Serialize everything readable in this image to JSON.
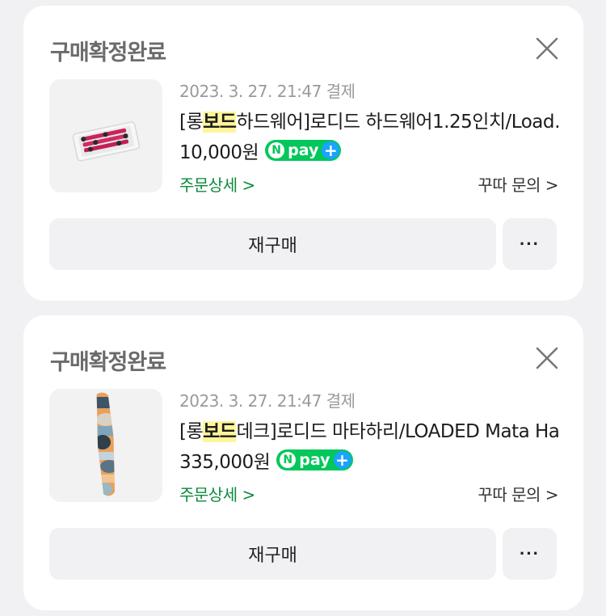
{
  "orders": [
    {
      "status": "구매확정완료",
      "date": "2023. 3. 27. 21:47 결제",
      "title_prefix": "[롱",
      "title_highlight": "보드",
      "title_suffix": "하드웨어]로디드 하드웨어1.25인치/Load…",
      "price": "10,000원",
      "npay_n": "N",
      "npay_text": "pay",
      "npay_plus": "+",
      "detail_label": "주문상세 >",
      "inquiry_label": "꾸따 문의 >",
      "rebuy_label": "재구매",
      "more_label": "···"
    },
    {
      "status": "구매확정완료",
      "date": "2023. 3. 27. 21:47 결제",
      "title_prefix": "[롱",
      "title_highlight": "보드",
      "title_suffix": "데크]로디드 마타하리/LOADED Mata Ha…",
      "price": "335,000원",
      "npay_n": "N",
      "npay_text": "pay",
      "npay_plus": "+",
      "detail_label": "주문상세 >",
      "inquiry_label": "꾸따 문의 >",
      "rebuy_label": "재구매",
      "more_label": "···"
    }
  ],
  "colors": {
    "background": "#f1f1f3",
    "card": "#ffffff",
    "status_text": "#6b6b6b",
    "date_text": "#9a9a9a",
    "highlight": "#fff59a",
    "npay_green": "#03c75a",
    "npay_plus_blue": "#1aa3ff",
    "detail_green": "#0c8a3c"
  },
  "icons": {
    "close": "close-icon",
    "product1": "longboard-hardware-product-image",
    "product2": "longboard-deck-product-image"
  }
}
